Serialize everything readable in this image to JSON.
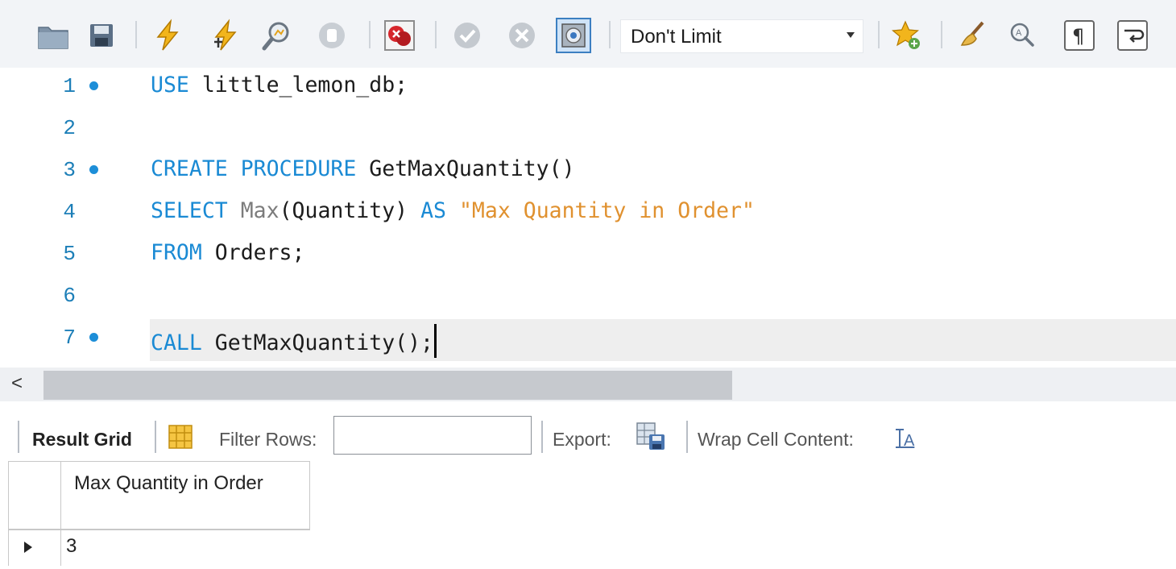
{
  "toolbar": {
    "icons": [
      "open-folder-icon",
      "save-icon",
      "execute-icon",
      "execute-current-icon",
      "explain-icon",
      "stop-icon",
      "toggle-error-icon",
      "commit-icon",
      "rollback-icon",
      "autocommit-icon",
      "add-snippet-icon",
      "beautify-icon",
      "find-icon",
      "invisible-chars-icon",
      "word-wrap-icon"
    ],
    "limit_value": "Don't Limit"
  },
  "editor": {
    "lines": [
      {
        "number": "1",
        "marker": true,
        "tokens": [
          {
            "t": "USE",
            "c": "kw"
          },
          {
            "t": " little_lemon_db;",
            "c": ""
          }
        ]
      },
      {
        "number": "2",
        "marker": false,
        "tokens": []
      },
      {
        "number": "3",
        "marker": true,
        "tokens": [
          {
            "t": "CREATE",
            "c": "kw"
          },
          {
            "t": " ",
            "c": ""
          },
          {
            "t": "PROCEDURE",
            "c": "kw"
          },
          {
            "t": " GetMaxQuantity()",
            "c": ""
          }
        ]
      },
      {
        "number": "4",
        "marker": false,
        "tokens": [
          {
            "t": "SELECT",
            "c": "kw"
          },
          {
            "t": " ",
            "c": ""
          },
          {
            "t": "Max",
            "c": "fn"
          },
          {
            "t": "(Quantity) ",
            "c": ""
          },
          {
            "t": "AS",
            "c": "kw"
          },
          {
            "t": " ",
            "c": ""
          },
          {
            "t": "\"Max Quantity in Order\"",
            "c": "str"
          }
        ]
      },
      {
        "number": "5",
        "marker": false,
        "tokens": [
          {
            "t": "FROM",
            "c": "kw"
          },
          {
            "t": " Orders;",
            "c": ""
          }
        ]
      },
      {
        "number": "6",
        "marker": false,
        "tokens": []
      },
      {
        "number": "7",
        "marker": true,
        "tokens": [
          {
            "t": "CALL",
            "c": "kw"
          },
          {
            "t": " GetMaxQuantity();",
            "c": ""
          }
        ]
      }
    ]
  },
  "scrollbar": {
    "left_arrow": "<"
  },
  "result_bar": {
    "result_grid_label": "Result Grid",
    "filter_label": "Filter Rows:",
    "filter_value": "",
    "export_label": "Export:",
    "wrap_label": "Wrap Cell Content:"
  },
  "grid": {
    "columns": [
      "Max Quantity in Order"
    ],
    "rows": [
      [
        "3"
      ]
    ]
  },
  "colors": {
    "keyword": "#1a8ad4",
    "string": "#e0912f",
    "function": "#7c7c7c",
    "line_number": "#1d7fb8"
  }
}
